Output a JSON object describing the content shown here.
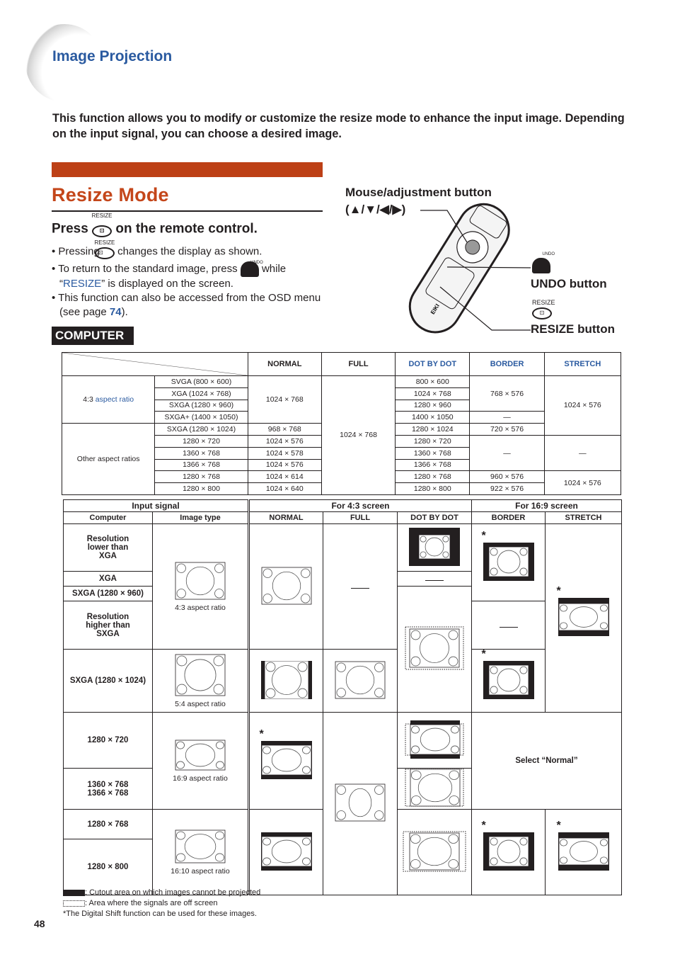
{
  "header": {
    "section_title": "Image Projection"
  },
  "intro": "This function allows you to modify or customize the resize mode to enhance the input image. Depending on the input signal, you can choose a desired image.",
  "heading": "Resize Mode",
  "press": {
    "prefix": "Press",
    "suffix": "on the remote control.",
    "button_label": "RESIZE"
  },
  "bullets": {
    "b1_pre": "• Pressing",
    "b1_post": "changes the display as shown.",
    "b2_pre": "• To return to the standard image, press",
    "b2_mid": "while",
    "b2_quote_open": "“",
    "b2_link": "RESIZE",
    "b2_post": "” is displayed on the screen.",
    "b3_pre": "• This function can also be accessed from the OSD menu (see page",
    "b3_page": "74",
    "b3_post": ").",
    "undo_label": "UNDO"
  },
  "tag": "COMPUTER",
  "remote": {
    "mouse_label": "Mouse/adjustment button",
    "mouse_arrows": "(▲/▼/◀/▶)",
    "undo_label": "UNDO button",
    "undo_small": "UNDO",
    "resize_label": "RESIZE button",
    "resize_small": "RESIZE",
    "brand": "EIKI"
  },
  "table1": {
    "headers": [
      "NORMAL",
      "FULL",
      "DOT BY DOT",
      "BORDER",
      "STRETCH"
    ],
    "group1_pre": "4:3",
    "group1_link": "aspect ratio",
    "group2": "Other aspect ratios",
    "rows": [
      [
        "SVGA (800 × 600)",
        "800 × 600"
      ],
      [
        "XGA (1024 × 768)",
        "1024 × 768"
      ],
      [
        "SXGA (1280 × 960)",
        "1280 × 960"
      ],
      [
        "SXGA+ (1400 × 1050)",
        "1400 × 1050"
      ],
      [
        "SXGA (1280 × 1024)",
        "1280 × 1024"
      ],
      [
        "1280 × 720",
        "1280 × 720"
      ],
      [
        "1360 × 768",
        "1360 × 768"
      ],
      [
        "1366 × 768",
        "1366 × 768"
      ],
      [
        "1280 × 768",
        "1280 × 768"
      ],
      [
        "1280 × 800",
        "1280 × 800"
      ]
    ],
    "normal": [
      "1024 × 768",
      "968 × 768",
      "1024 × 576",
      "1024 × 578",
      "1024 × 576",
      "1024 × 614",
      "1024 × 640"
    ],
    "full": "1024 × 768",
    "border": [
      "768 × 576",
      "—",
      "720 × 576",
      "—",
      "960 × 576",
      "922 × 576"
    ],
    "stretch": [
      "1024 × 576",
      "—",
      "1024 × 576"
    ]
  },
  "table2": {
    "input_signal": "Input signal",
    "for43": "For 4:3 screen",
    "for169": "For 16:9 screen",
    "sub": [
      "Computer",
      "Image type",
      "NORMAL",
      "FULL",
      "DOT BY DOT",
      "BORDER",
      "STRETCH"
    ],
    "computers": [
      "Resolution lower than XGA",
      "XGA",
      "SXGA (1280 × 960)",
      "Resolution higher than SXGA",
      "SXGA (1280 × 1024)",
      "1280 × 720",
      "1360 × 768\n1366 × 768",
      "1280 × 768",
      "1280 × 800"
    ],
    "captions": [
      "4:3 aspect ratio",
      "5:4 aspect ratio",
      "16:9 aspect ratio",
      "16:10 aspect ratio"
    ],
    "select_normal": "Select “Normal”",
    "star": "*"
  },
  "legend": {
    "black": ": Cutout area on which images cannot be projected",
    "dotted": ": Area where the signals are off screen",
    "note": "*The Digital Shift function can be used for these images."
  },
  "page_number": "48"
}
